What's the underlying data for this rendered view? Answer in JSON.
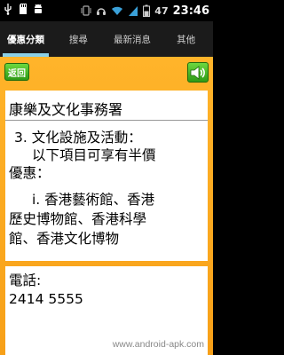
{
  "status_bar": {
    "battery_percent": "47",
    "clock": "23:46",
    "icons": [
      "usb-icon",
      "sd-card-icon",
      "android-debug-icon",
      "vibrate-icon",
      "headset-icon",
      "wifi-icon",
      "signal-icon",
      "battery-icon"
    ]
  },
  "tabs": [
    {
      "label": "優惠分類",
      "active": true
    },
    {
      "label": "搜尋",
      "active": false
    },
    {
      "label": "最新消息",
      "active": false
    },
    {
      "label": "其他",
      "active": false
    }
  ],
  "toolbar": {
    "back_label": "返回",
    "speaker_icon": "speaker-icon"
  },
  "content": {
    "department": "康樂及文化事務署",
    "lines": [
      "3.   文化設施及活動：",
      "以下項目可享有半價",
      "優惠：",
      "i. 香港藝術館、香港",
      "歷史博物館、香港科學",
      "館、香港文化博物"
    ]
  },
  "contact": {
    "phone_label": "電話:",
    "phone_number": "2414 5555"
  },
  "watermark": "www.android-apk.com",
  "colors": {
    "panel": "#f7a018",
    "button_green": "#3aa81c",
    "tab_indicator": "#8ad0e8"
  }
}
